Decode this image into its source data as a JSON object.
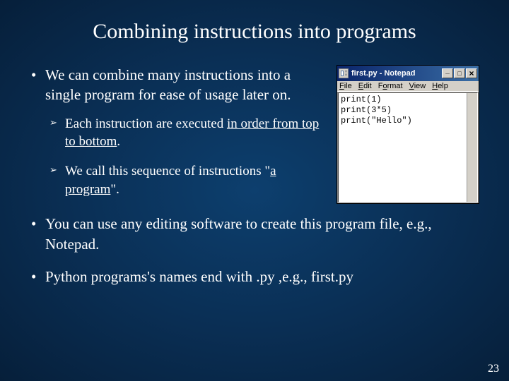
{
  "title": "Combining instructions into programs",
  "bullets": {
    "b1": "We can combine many instructions into a single program for ease of usage later on.",
    "sub1_pre": "Each instruction are executed ",
    "sub1_u": "in order from top to bottom",
    "sub1_post": ".",
    "sub2_pre": "We call this sequence of instructions ",
    "sub2_q1": "\"",
    "sub2_u": "a program",
    "sub2_q2": "\"",
    "sub2_post": ".",
    "b2": "You can use any editing software to create this program file, e.g., Notepad.",
    "b3": "Python programs's names end with .py ,e.g., first.py"
  },
  "notepad": {
    "title": "first.py - Notepad",
    "menu": {
      "file": "File",
      "edit": "Edit",
      "format": "Format",
      "view": "View",
      "help": "Help"
    },
    "code": "print(1)\nprint(3*5)\nprint(\"Hello\")"
  },
  "page": "23"
}
